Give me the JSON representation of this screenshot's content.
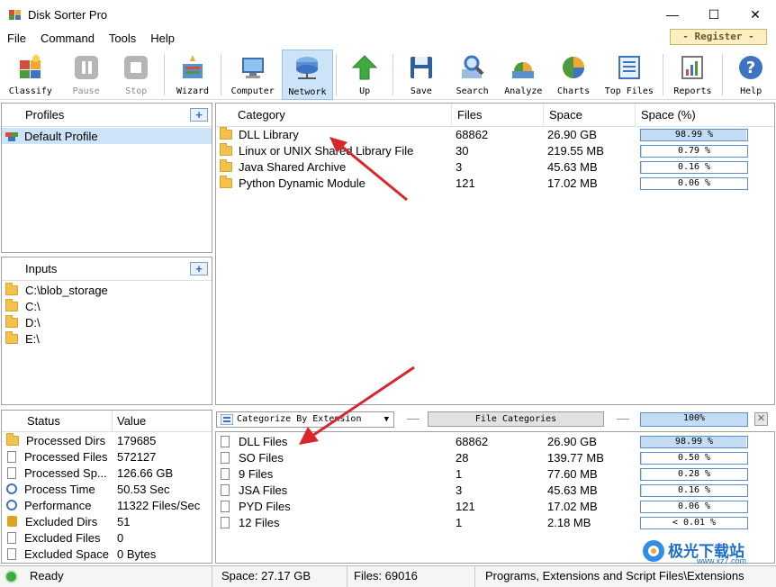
{
  "window": {
    "title": "Disk Sorter Pro",
    "minimize": "—",
    "maximize": "☐",
    "close": "✕"
  },
  "menu": [
    "File",
    "Command",
    "Tools",
    "Help"
  ],
  "register_label": "- Register -",
  "toolbar": [
    {
      "label": "Classify",
      "icon": "classify-icon",
      "state": "normal"
    },
    {
      "label": "Pause",
      "icon": "pause-icon",
      "state": "disabled"
    },
    {
      "label": "Stop",
      "icon": "stop-icon",
      "state": "disabled"
    },
    {
      "label": "Wizard",
      "icon": "wizard-icon",
      "state": "normal"
    },
    {
      "label": "Computer",
      "icon": "computer-icon",
      "state": "normal"
    },
    {
      "label": "Network",
      "icon": "network-icon",
      "state": "active"
    },
    {
      "label": "Up",
      "icon": "up-arrow-icon",
      "state": "normal"
    },
    {
      "label": "Save",
      "icon": "save-icon",
      "state": "normal"
    },
    {
      "label": "Search",
      "icon": "search-icon",
      "state": "normal"
    },
    {
      "label": "Analyze",
      "icon": "analyze-icon",
      "state": "normal"
    },
    {
      "label": "Charts",
      "icon": "charts-icon",
      "state": "normal"
    },
    {
      "label": "Top Files",
      "icon": "top-files-icon",
      "state": "normal"
    },
    {
      "label": "Reports",
      "icon": "reports-icon",
      "state": "normal"
    },
    {
      "label": "Help",
      "icon": "help-icon",
      "state": "normal"
    }
  ],
  "profiles": {
    "header": "Profiles",
    "items": [
      "Default Profile"
    ]
  },
  "inputs": {
    "header": "Inputs",
    "items": [
      "C:\\blob_storage",
      "C:\\",
      "D:\\",
      "E:\\"
    ]
  },
  "status": {
    "col_status": "Status",
    "col_value": "Value",
    "rows": [
      {
        "label": "Processed Dirs",
        "value": "179685",
        "icon": "folder-icon"
      },
      {
        "label": "Processed Files",
        "value": "572127",
        "icon": "files-icon"
      },
      {
        "label": "Processed Sp...",
        "value": "126.66 GB",
        "icon": "disk-icon"
      },
      {
        "label": "Process Time",
        "value": "50.53 Sec",
        "icon": "clock-icon"
      },
      {
        "label": "Performance",
        "value": "11322 Files/Sec",
        "icon": "performance-icon"
      },
      {
        "label": "Excluded Dirs",
        "value": "51",
        "icon": "lock-icon"
      },
      {
        "label": "Excluded Files",
        "value": "0",
        "icon": "excluded-files-icon"
      },
      {
        "label": "Excluded Space",
        "value": "0 Bytes",
        "icon": "excluded-space-icon"
      }
    ]
  },
  "categories": {
    "headers": [
      "Category",
      "Files",
      "Space",
      "Space (%)"
    ],
    "rows": [
      {
        "name": "DLL Library",
        "files": "68862",
        "space": "26.90 GB",
        "pct_label": "98.99 %",
        "pct": 98.99
      },
      {
        "name": "Linux or UNIX Shared Library File",
        "files": "30",
        "space": "219.55 MB",
        "pct_label": "0.79 %",
        "pct": 0.79
      },
      {
        "name": "Java Shared Archive",
        "files": "3",
        "space": "45.63 MB",
        "pct_label": "0.16 %",
        "pct": 0.16
      },
      {
        "name": "Python Dynamic Module",
        "files": "121",
        "space": "17.02 MB",
        "pct_label": "0.06 %",
        "pct": 0.06
      }
    ]
  },
  "midbar": {
    "combo_value": "Categorize By Extension",
    "file_categories_button": "File Categories",
    "total_pct_label": "100%",
    "close_button": "✕"
  },
  "extensions": {
    "rows": [
      {
        "name": "DLL Files",
        "files": "68862",
        "space": "26.90 GB",
        "pct_label": "98.99 %",
        "pct": 98.99
      },
      {
        "name": "SO Files",
        "files": "28",
        "space": "139.77 MB",
        "pct_label": "0.50 %",
        "pct": 0.5
      },
      {
        "name": "9 Files",
        "files": "1",
        "space": "77.60 MB",
        "pct_label": "0.28 %",
        "pct": 0.28
      },
      {
        "name": "JSA Files",
        "files": "3",
        "space": "45.63 MB",
        "pct_label": "0.16 %",
        "pct": 0.16
      },
      {
        "name": "PYD Files",
        "files": "121",
        "space": "17.02 MB",
        "pct_label": "0.06 %",
        "pct": 0.06
      },
      {
        "name": "12 Files",
        "files": "1",
        "space": "2.18 MB",
        "pct_label": "< 0.01 %",
        "pct": 0.01
      }
    ]
  },
  "statusbar": {
    "ready": "Ready",
    "space": "Space: 27.17 GB",
    "files": "Files: 69016",
    "path": "Programs, Extensions and Script Files\\Extensions"
  },
  "watermark": {
    "text": "极光下载站",
    "url": "www.xz7.com"
  },
  "colors": {
    "folder": "#f2c14e",
    "bar_fill": "#c3dcf3",
    "bar_border": "#5b8fc7",
    "annotation_arrow": "#d9262b",
    "selection": "#cde3f7"
  }
}
